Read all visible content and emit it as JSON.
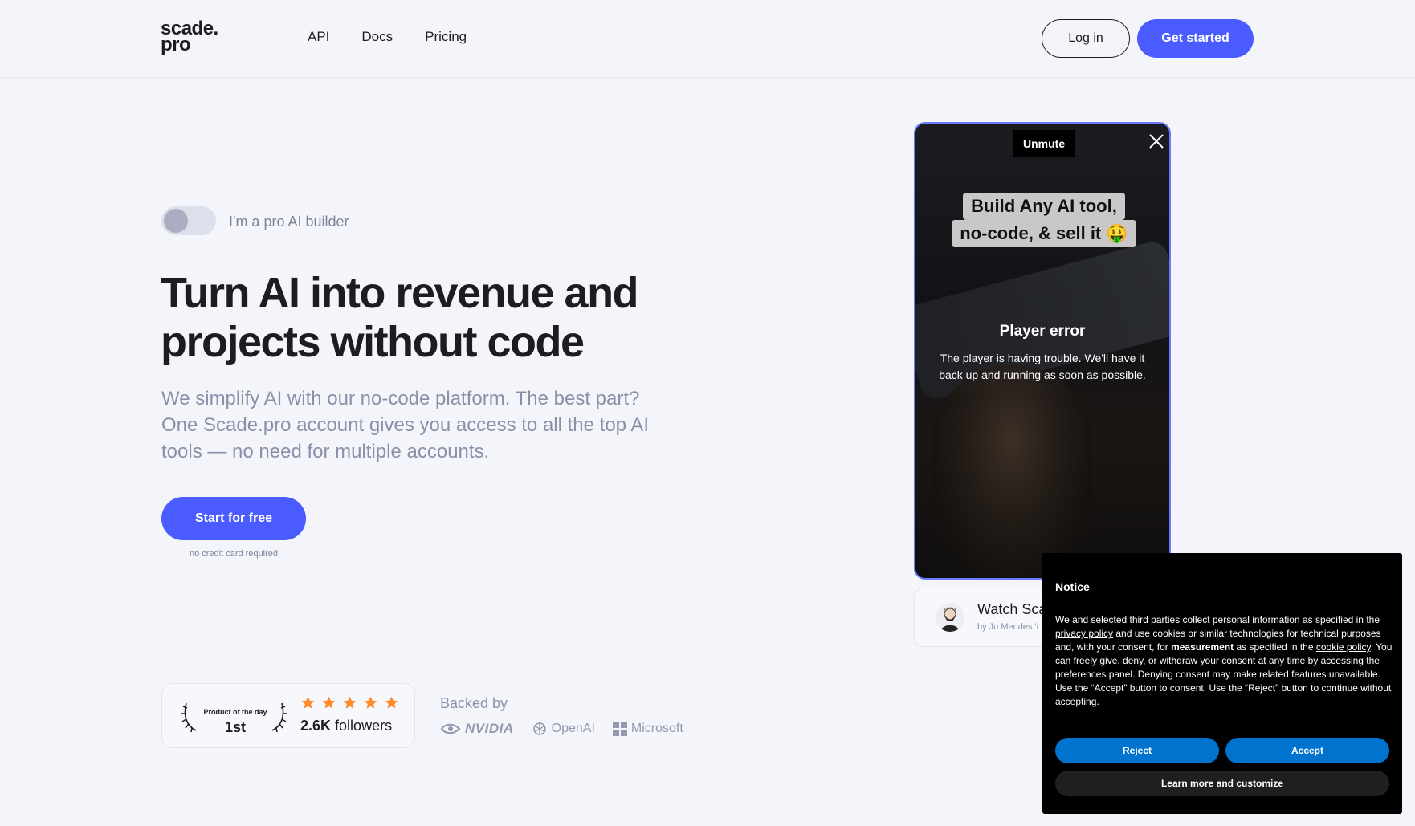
{
  "header": {
    "logo_line1": "scade.",
    "logo_line2": "pro",
    "nav": [
      "API",
      "Docs",
      "Pricing"
    ],
    "login_label": "Log in",
    "get_started_label": "Get started"
  },
  "hero": {
    "toggle_label": "I'm a pro AI builder",
    "toggle_on": false,
    "title": "Turn AI into revenue and projects without code",
    "subtitle": "We simplify AI with our no-code platform. The best part? One Scade.pro account gives you access to all the top AI tools — no need for multiple accounts.",
    "cta_label": "Start for free",
    "cta_note": "no credit card required"
  },
  "product_badge": {
    "label": "Product of the day",
    "rank": "1st",
    "stars": 5,
    "followers_count": "2.6K",
    "followers_text": "followers"
  },
  "backed": {
    "label": "Backed by",
    "logos": [
      "NVIDIA",
      "OpenAI",
      "Microsoft"
    ]
  },
  "video": {
    "unmute_label": "Unmute",
    "caption_line1": "Build Any AI tool,",
    "caption_line2": "no-code, & sell it 🤑",
    "error_title": "Player error",
    "error_message": "The player is having trouble. We'll have it back up and running as soon as possible."
  },
  "watch_card": {
    "title": "Watch Sca",
    "by": "by Jo Mendes 'r"
  },
  "notice": {
    "title": "Notice",
    "text_1": "We and selected third parties collect personal information as specified in the ",
    "privacy_link": "privacy policy",
    "text_2": " and use cookies or similar technologies for technical purposes and, with your consent, for ",
    "measurement": "measurement",
    "text_3": " as specified in the ",
    "cookie_link": "cookie policy",
    "text_4": ". You can freely give, deny, or withdraw your consent at any time by accessing the preferences panel. Denying consent may make related features unavailable.",
    "text_5": "Use the “Accept” button to consent. Use the “Reject” button to continue without accepting.",
    "reject_label": "Reject",
    "accept_label": "Accept",
    "learn_label": "Learn more and customize"
  },
  "colors": {
    "accent": "#4a5cff",
    "background": "#f4f5fa",
    "notice_button": "#0073ce",
    "star": "#ff8a2a"
  }
}
